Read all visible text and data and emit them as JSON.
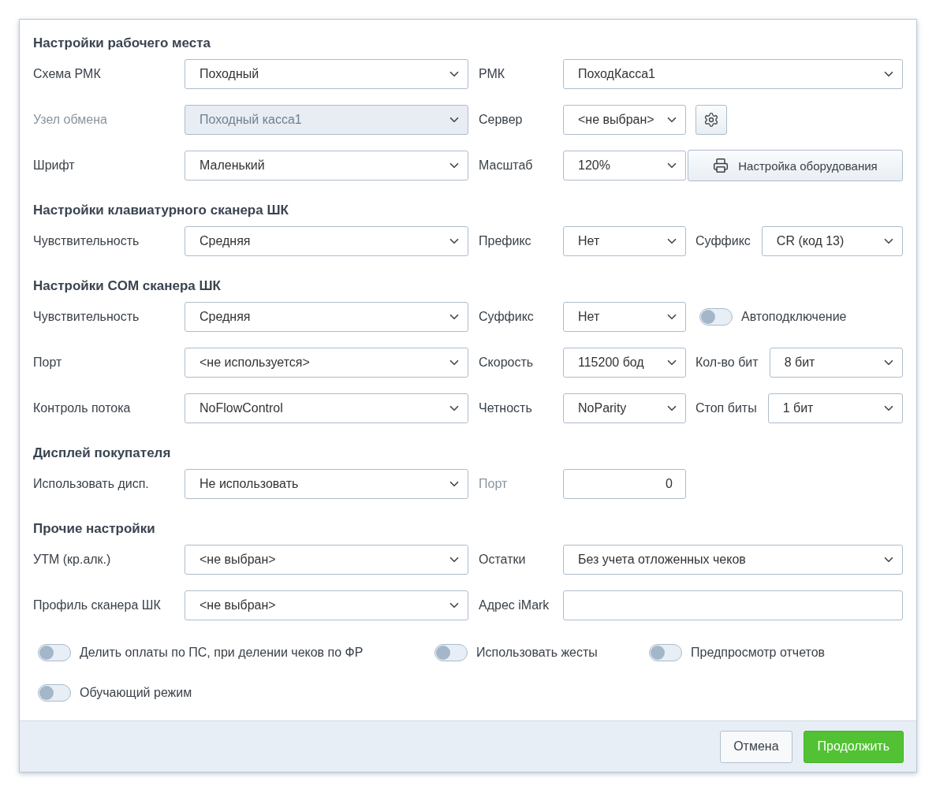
{
  "dialog": {
    "sections": [
      {
        "title": "Настройки рабочего места",
        "rows": [
          {
            "items": [
              {
                "kind": "label",
                "text": "Схема РМК",
                "disabled": false
              },
              {
                "kind": "select",
                "value": "Походный",
                "disabled": false
              },
              {
                "kind": "label",
                "text": "РМК",
                "disabled": false
              },
              {
                "kind": "select",
                "value": "ПоходКасса1",
                "disabled": false
              }
            ]
          },
          {
            "items": [
              {
                "kind": "label",
                "text": "Узел обмена",
                "disabled": true
              },
              {
                "kind": "select",
                "value": "Походный касса1",
                "disabled": true
              },
              {
                "kind": "label",
                "text": "Сервер",
                "disabled": false
              },
              {
                "kind": "select",
                "value": "<не выбран>",
                "disabled": false
              },
              {
                "kind": "icon_button"
              }
            ]
          },
          {
            "items": [
              {
                "kind": "label",
                "text": "Шрифт",
                "disabled": false
              },
              {
                "kind": "select",
                "value": "Маленький",
                "disabled": false
              },
              {
                "kind": "label",
                "text": "Масштаб",
                "disabled": false
              },
              {
                "kind": "select",
                "value": "120%",
                "disabled": false
              },
              {
                "kind": "button",
                "text": "Настройка оборудования"
              }
            ]
          }
        ]
      },
      {
        "title": "Настройки клавиатурного сканера ШК",
        "rows": [
          {
            "items": [
              {
                "kind": "label",
                "text": "Чувствительность",
                "disabled": false
              },
              {
                "kind": "select",
                "value": "Средняя",
                "disabled": false
              },
              {
                "kind": "label",
                "text": "Префикс",
                "disabled": false
              },
              {
                "kind": "select",
                "value": "Нет",
                "disabled": false
              },
              {
                "kind": "label",
                "text": "Суффикс",
                "disabled": false
              },
              {
                "kind": "select",
                "value": "CR (код 13)",
                "disabled": false
              }
            ]
          }
        ]
      },
      {
        "title": "Настройки COM сканера ШК",
        "rows": [
          {
            "items": [
              {
                "kind": "label",
                "text": "Чувствительность",
                "disabled": false
              },
              {
                "kind": "select",
                "value": "Средняя",
                "disabled": false
              },
              {
                "kind": "label",
                "text": "Суффикс",
                "disabled": false
              },
              {
                "kind": "select",
                "value": "Нет",
                "disabled": false
              },
              {
                "kind": "toggle",
                "text": "Автоподключение",
                "on": false
              }
            ]
          },
          {
            "items": [
              {
                "kind": "label",
                "text": "Порт",
                "disabled": false
              },
              {
                "kind": "select",
                "value": "<не используется>",
                "disabled": false
              },
              {
                "kind": "label",
                "text": "Скорость",
                "disabled": false
              },
              {
                "kind": "select",
                "value": "115200 бод",
                "disabled": false
              },
              {
                "kind": "label",
                "text": "Кол-во бит",
                "disabled": false
              },
              {
                "kind": "select",
                "value": "8 бит",
                "disabled": false
              }
            ]
          },
          {
            "items": [
              {
                "kind": "label",
                "text": "Контроль потока",
                "disabled": false
              },
              {
                "kind": "select",
                "value": "NoFlowControl",
                "disabled": false
              },
              {
                "kind": "label",
                "text": "Четность",
                "disabled": false
              },
              {
                "kind": "select",
                "value": "NoParity",
                "disabled": false
              },
              {
                "kind": "label",
                "text": "Стоп биты",
                "disabled": false
              },
              {
                "kind": "select",
                "value": "1 бит",
                "disabled": false
              }
            ]
          }
        ]
      },
      {
        "title": "Дисплей покупателя",
        "rows": [
          {
            "items": [
              {
                "kind": "label",
                "text": "Использовать дисп.",
                "disabled": false
              },
              {
                "kind": "select",
                "value": "Не использовать",
                "disabled": false
              },
              {
                "kind": "label",
                "text": "Порт",
                "disabled": true
              },
              {
                "kind": "number",
                "value": "0"
              }
            ]
          }
        ]
      },
      {
        "title": "Прочие настройки",
        "rows": [
          {
            "items": [
              {
                "kind": "label",
                "text": "УТМ (кр.алк.)",
                "disabled": false
              },
              {
                "kind": "select",
                "value": "<не выбран>",
                "disabled": false
              },
              {
                "kind": "label",
                "text": "Остатки",
                "disabled": false
              },
              {
                "kind": "select",
                "value": "Без учета отложенных чеков",
                "disabled": false
              }
            ]
          },
          {
            "items": [
              {
                "kind": "label",
                "text": "Профиль сканера ШК",
                "disabled": false
              },
              {
                "kind": "select",
                "value": "<не выбран>",
                "disabled": false
              },
              {
                "kind": "label",
                "text": "Адрес iMark",
                "disabled": false
              },
              {
                "kind": "text",
                "value": ""
              }
            ]
          }
        ]
      }
    ],
    "toggles": [
      {
        "label": "Делить оплаты по ПС, при делении чеков по ФР",
        "on": false
      },
      {
        "label": "Использовать жесты",
        "on": false
      },
      {
        "label": "Предпросмотр отчетов",
        "on": false
      },
      {
        "label": "Обучающий режим",
        "on": false
      }
    ],
    "buttons": [
      {
        "label": "Отмена",
        "kind": "secondary"
      },
      {
        "label": "Продолжить",
        "kind": "primary"
      }
    ]
  }
}
